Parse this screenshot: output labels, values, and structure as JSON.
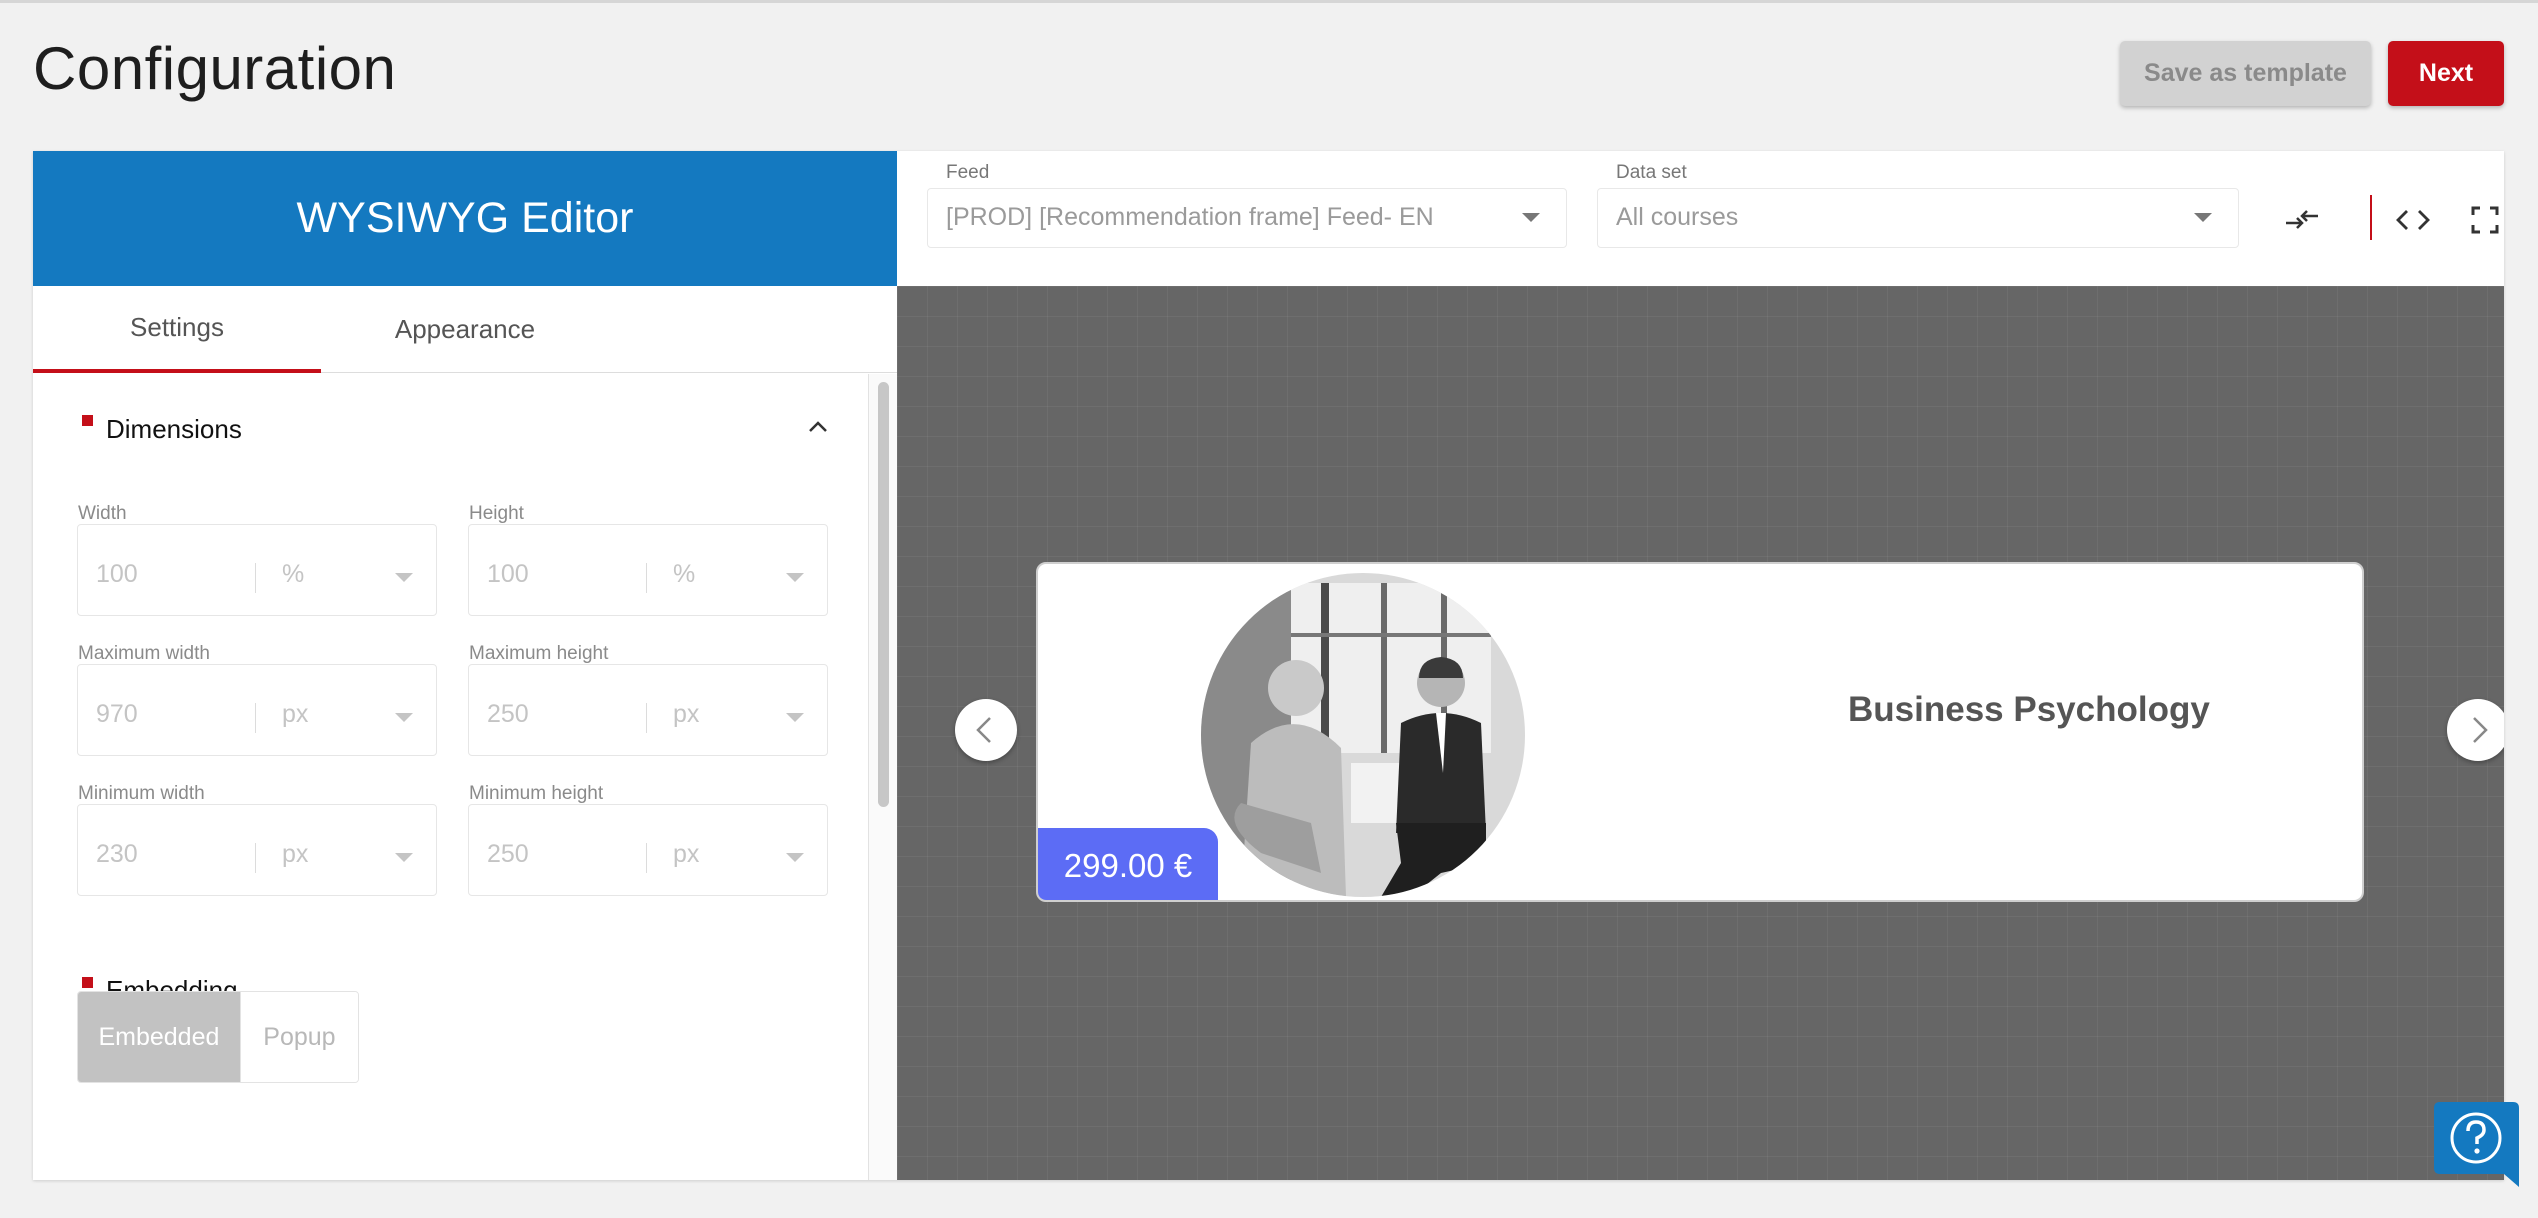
{
  "page": {
    "title": "Configuration"
  },
  "header": {
    "save_template_label": "Save as template",
    "next_label": "Next"
  },
  "editor": {
    "title": "WYSIWYG Editor",
    "tabs": [
      {
        "label": "Settings",
        "active": true
      },
      {
        "label": "Appearance",
        "active": false
      }
    ],
    "dimensions": {
      "title": "Dimensions",
      "width": {
        "label": "Width",
        "value": "100",
        "unit": "%"
      },
      "height": {
        "label": "Height",
        "value": "100",
        "unit": "%"
      },
      "max_width": {
        "label": "Maximum width",
        "value": "970",
        "unit": "px"
      },
      "max_height": {
        "label": "Maximum height",
        "value": "250",
        "unit": "px"
      },
      "min_width": {
        "label": "Minimum width",
        "value": "230",
        "unit": "px"
      },
      "min_height": {
        "label": "Minimum height",
        "value": "250",
        "unit": "px"
      }
    },
    "embedding": {
      "title": "Embedding",
      "options": [
        "Embedded",
        "Popup"
      ],
      "selected": "Embedded"
    }
  },
  "toolbar": {
    "feed": {
      "label": "Feed",
      "value": "[PROD] [Recommendation frame] Feed- EN"
    },
    "dataset": {
      "label": "Data set",
      "value": "All courses"
    }
  },
  "preview": {
    "title": "Business Psychology",
    "price": "299.00 €"
  },
  "colors": {
    "brand_red": "#c40f19",
    "header_blue": "#1479c0",
    "price_badge": "#5c6cf5"
  },
  "icons": [
    "swap-icon",
    "code-icon",
    "fullscreen-icon",
    "chevron-up-icon",
    "chevron-left-icon",
    "chevron-right-icon",
    "help-icon"
  ]
}
